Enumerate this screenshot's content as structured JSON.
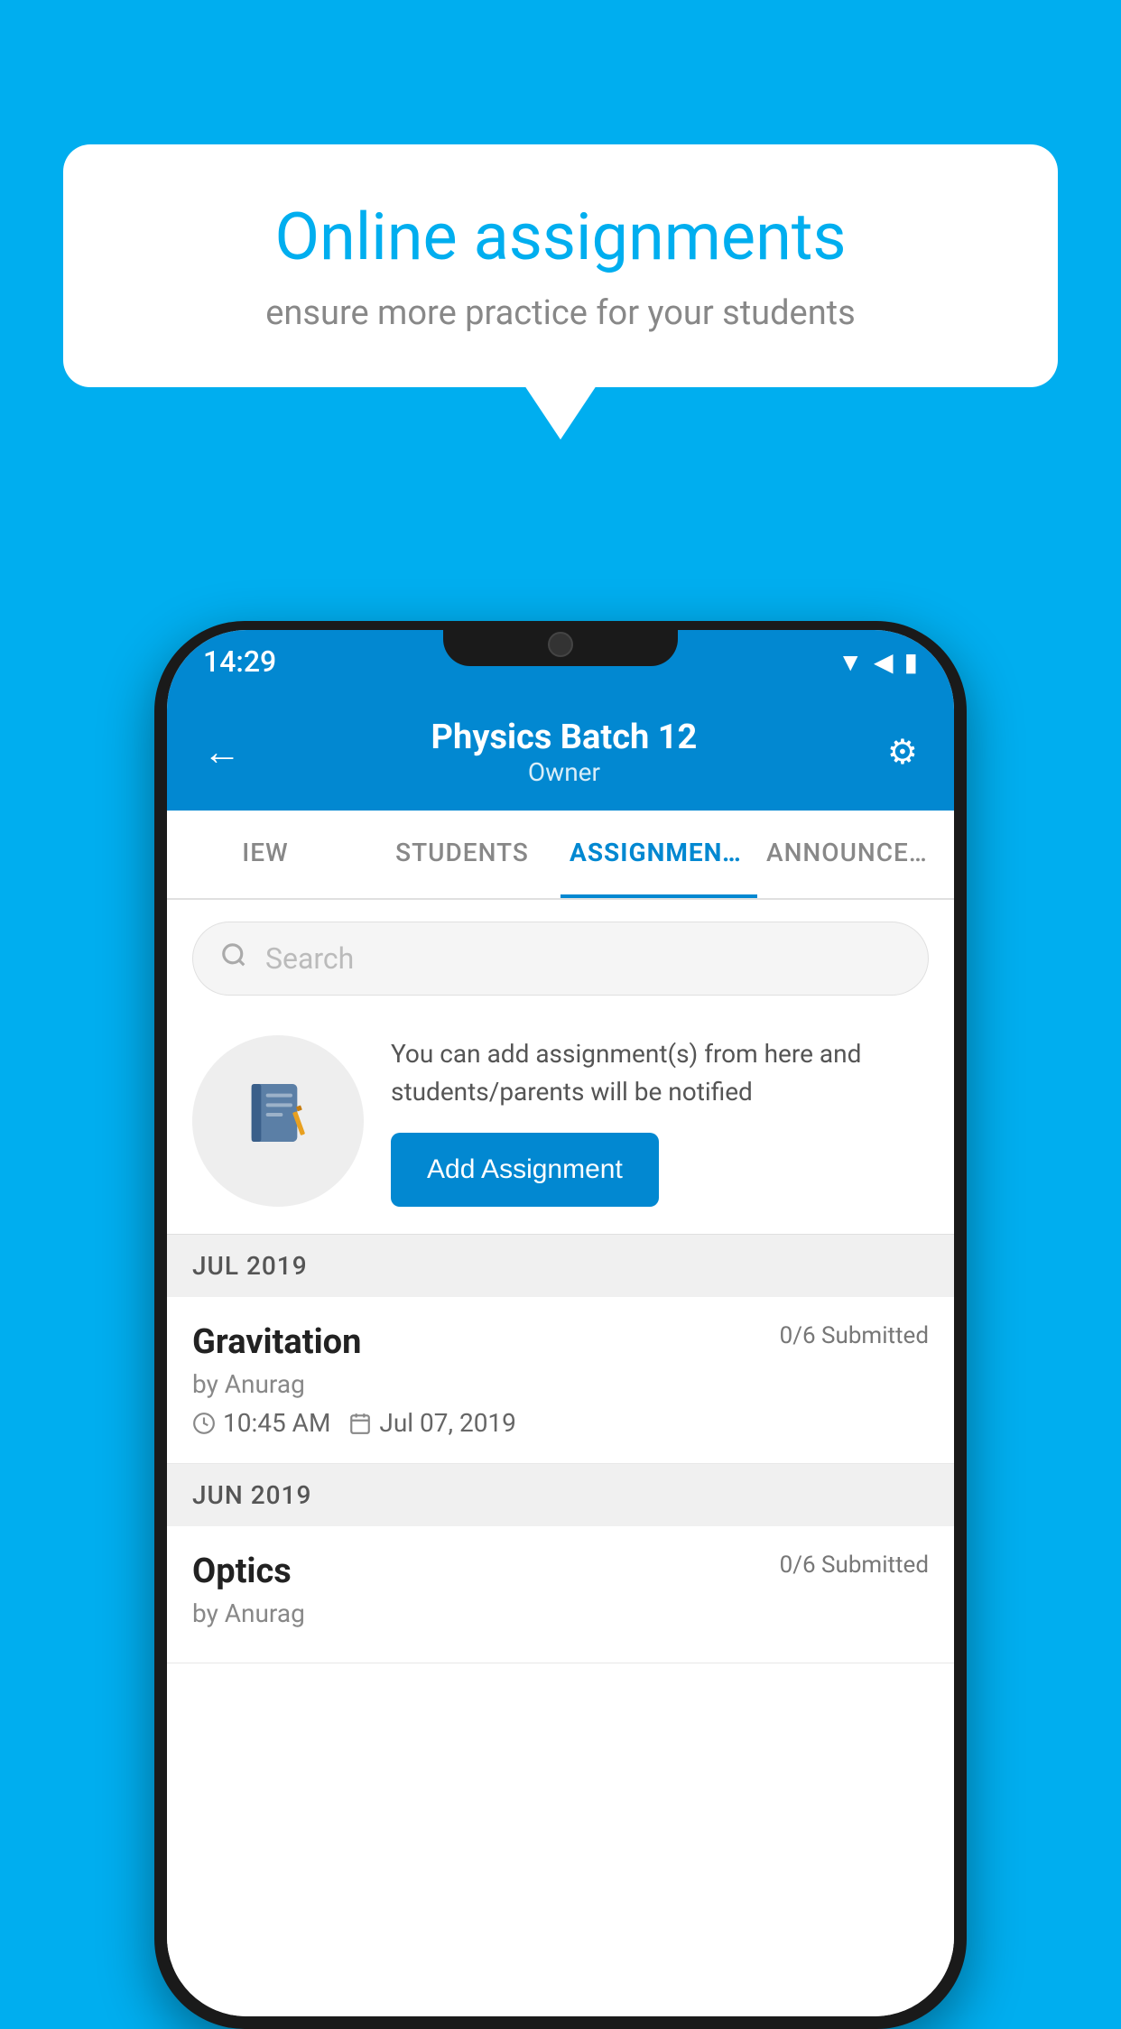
{
  "background_color": "#00AEEF",
  "speech_bubble": {
    "title": "Online assignments",
    "subtitle": "ensure more practice for your students"
  },
  "status_bar": {
    "time": "14:29",
    "icons": [
      "wifi",
      "signal",
      "battery"
    ]
  },
  "header": {
    "title": "Physics Batch 12",
    "subtitle": "Owner",
    "back_label": "←",
    "settings_label": "⚙"
  },
  "tabs": [
    {
      "id": "overview",
      "label": "IEW",
      "active": false
    },
    {
      "id": "students",
      "label": "STUDENTS",
      "active": false
    },
    {
      "id": "assignments",
      "label": "ASSIGNMENTS",
      "active": true
    },
    {
      "id": "announcements",
      "label": "ANNOUNCEMENTS",
      "active": false
    }
  ],
  "search": {
    "placeholder": "Search"
  },
  "promo": {
    "description": "You can add assignment(s) from here and students/parents will be notified",
    "button_label": "Add Assignment"
  },
  "assignments": [
    {
      "month_header": "JUL 2019",
      "title": "Gravitation",
      "submitted": "0/6 Submitted",
      "by": "by Anurag",
      "time": "10:45 AM",
      "date": "Jul 07, 2019"
    },
    {
      "month_header": "JUN 2019",
      "title": "Optics",
      "submitted": "0/6 Submitted",
      "by": "by Anurag",
      "time": "",
      "date": ""
    }
  ]
}
